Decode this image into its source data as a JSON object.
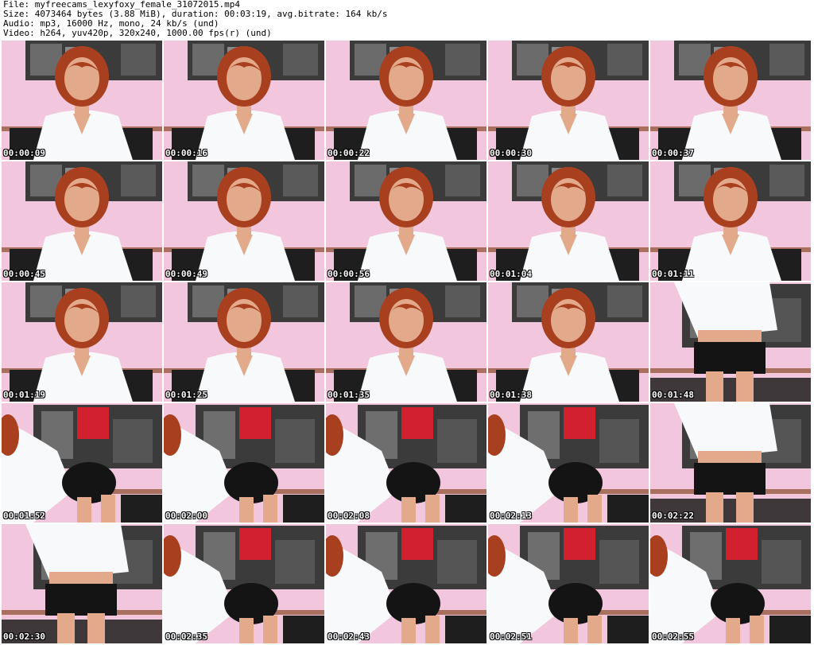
{
  "header": {
    "file": "File: myfreecams_lexyfoxy_female_31072015.mp4",
    "size": "Size: 4073464 bytes (3.88 MiB), duration: 00:03:19, avg.bitrate: 164 kb/s",
    "audio": "Audio: mp3, 16000 Hz, mono, 24 kb/s (und)",
    "video": "Video: h264, yuv420p, 320x240, 1000.00 fps(r) (und)"
  },
  "thumbnails": [
    {
      "time": "00:00:09",
      "scene": "portrait"
    },
    {
      "time": "00:00:16",
      "scene": "portrait"
    },
    {
      "time": "00:00:22",
      "scene": "portrait"
    },
    {
      "time": "00:00:30",
      "scene": "portrait"
    },
    {
      "time": "00:00:37",
      "scene": "portrait"
    },
    {
      "time": "00:00:45",
      "scene": "portrait"
    },
    {
      "time": "00:00:49",
      "scene": "portrait"
    },
    {
      "time": "00:00:56",
      "scene": "portrait"
    },
    {
      "time": "00:01:04",
      "scene": "portrait"
    },
    {
      "time": "00:01:11",
      "scene": "portrait"
    },
    {
      "time": "00:01:19",
      "scene": "portrait"
    },
    {
      "time": "00:01:25",
      "scene": "portrait"
    },
    {
      "time": "00:01:35",
      "scene": "portrait"
    },
    {
      "time": "00:01:38",
      "scene": "portrait"
    },
    {
      "time": "00:01:48",
      "scene": "standing"
    },
    {
      "time": "00:01:52",
      "scene": "bending"
    },
    {
      "time": "00:02:00",
      "scene": "bending"
    },
    {
      "time": "00:02:08",
      "scene": "bending"
    },
    {
      "time": "00:02:13",
      "scene": "bending"
    },
    {
      "time": "00:02:22",
      "scene": "standing"
    },
    {
      "time": "00:02:30",
      "scene": "standing"
    },
    {
      "time": "00:02:35",
      "scene": "bending"
    },
    {
      "time": "00:02:43",
      "scene": "bending"
    },
    {
      "time": "00:02:51",
      "scene": "bending"
    },
    {
      "time": "00:02:55",
      "scene": "bending"
    }
  ],
  "colors": {
    "wall": "#f2c6dc",
    "poster": "#3b3b3b",
    "bus": "#d3202e",
    "hair": "#a8401f",
    "skin": "#e2a98a",
    "shirt": "#f7f9fb",
    "skirt": "#141414",
    "floor": "#8a4a2a",
    "chair": "#1e1e1e"
  }
}
